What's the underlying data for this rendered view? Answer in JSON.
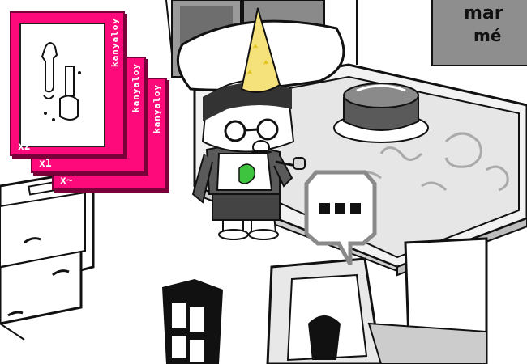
{
  "inventory": {
    "cards": [
      {
        "count": "x~",
        "code": "kanyaloy"
      },
      {
        "count": "x1",
        "code": "kanyaloy"
      },
      {
        "count": "x2",
        "code": "kanyaloy"
      }
    ]
  },
  "poster": {
    "line1": "mar",
    "line2": "mé"
  },
  "speech_bubble": {
    "text": "..."
  },
  "colors": {
    "card": "#ff0a7a",
    "card_shadow": "#7a003a",
    "hat": "#f5e27a",
    "star": "#e0c21a",
    "mascot": "#3ec43e"
  }
}
